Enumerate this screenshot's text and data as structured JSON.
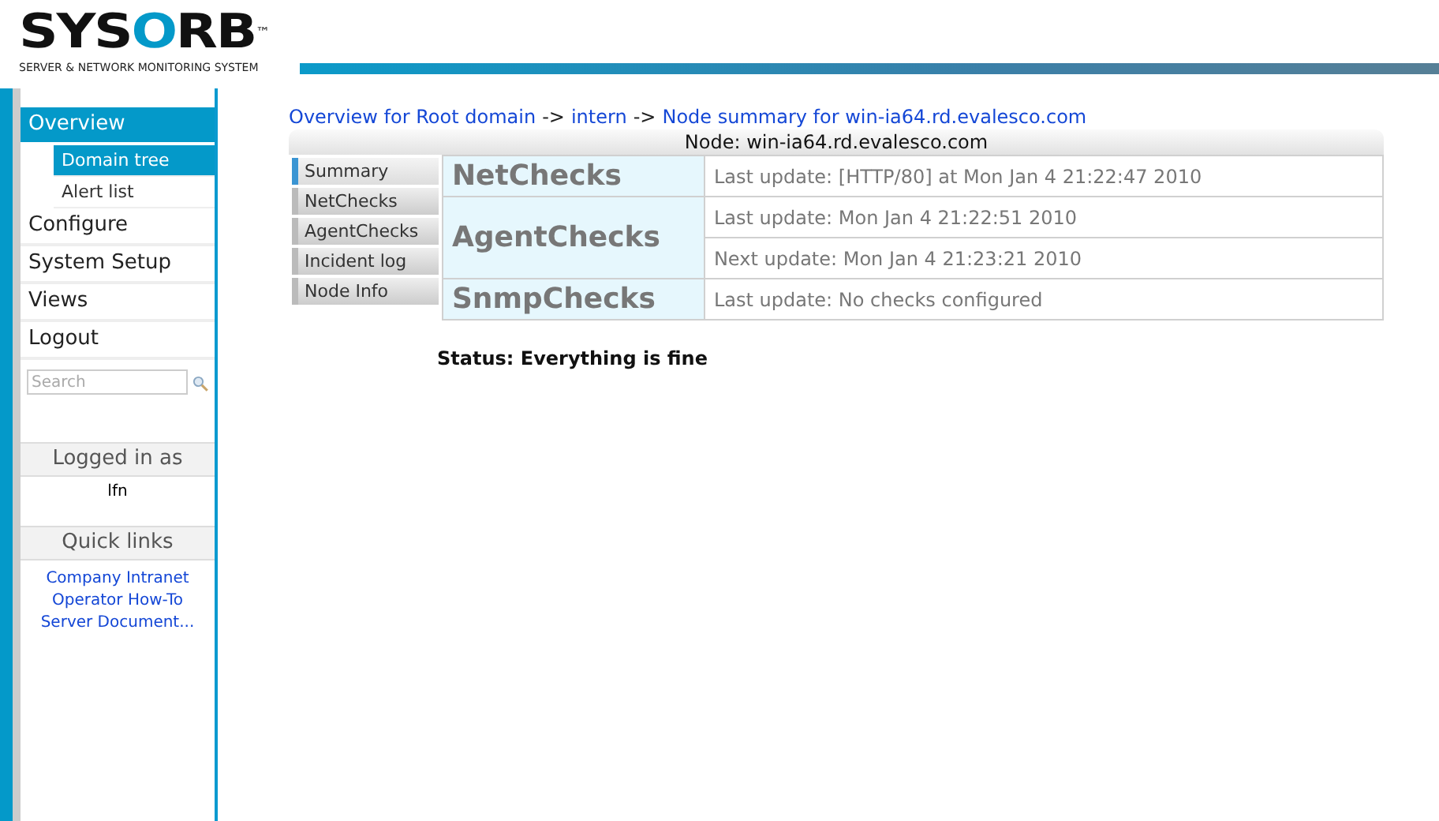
{
  "logo": {
    "prefix": "SYS",
    "accent": "O",
    "suffix": "RB",
    "mark": "™",
    "tagline": "SERVER & NETWORK MONITORING SYSTEM"
  },
  "sidebar": {
    "items": [
      {
        "label": "Overview",
        "selected": true,
        "children": [
          {
            "label": "Domain tree",
            "selected": true
          },
          {
            "label": "Alert list",
            "selected": false
          }
        ]
      },
      {
        "label": "Configure",
        "selected": false
      },
      {
        "label": "System Setup",
        "selected": false
      },
      {
        "label": "Views",
        "selected": false
      },
      {
        "label": "Logout",
        "selected": false
      }
    ],
    "search": {
      "placeholder": "Search"
    },
    "logged_in": {
      "title": "Logged in as",
      "user": "lfn"
    },
    "quick_links": {
      "title": "Quick links",
      "links": [
        "Company Intranet",
        "Operator How-To",
        "Server Document..."
      ]
    }
  },
  "breadcrumb": [
    {
      "label": "Overview for Root domain"
    },
    {
      "label": "intern"
    },
    {
      "label": "Node summary for win-ia64.rd.evalesco.com"
    }
  ],
  "breadcrumb_separator": "->",
  "panel": {
    "title": "Node: win-ia64.rd.evalesco.com",
    "tabs": [
      {
        "label": "Summary",
        "selected": true
      },
      {
        "label": "NetChecks",
        "selected": false
      },
      {
        "label": "AgentChecks",
        "selected": false
      },
      {
        "label": "Incident log",
        "selected": false
      },
      {
        "label": "Node Info",
        "selected": false
      }
    ],
    "rows": [
      {
        "name": "NetChecks",
        "updates": [
          "Last update: [HTTP/80] at Mon Jan 4 21:22:47 2010"
        ]
      },
      {
        "name": "AgentChecks",
        "updates": [
          "Last update: Mon Jan 4 21:22:51 2010",
          "Next update: Mon Jan 4 21:23:21 2010"
        ]
      },
      {
        "name": "SnmpChecks",
        "updates": [
          "Last update: No checks configured"
        ]
      }
    ],
    "status": "Status: Everything is fine"
  }
}
